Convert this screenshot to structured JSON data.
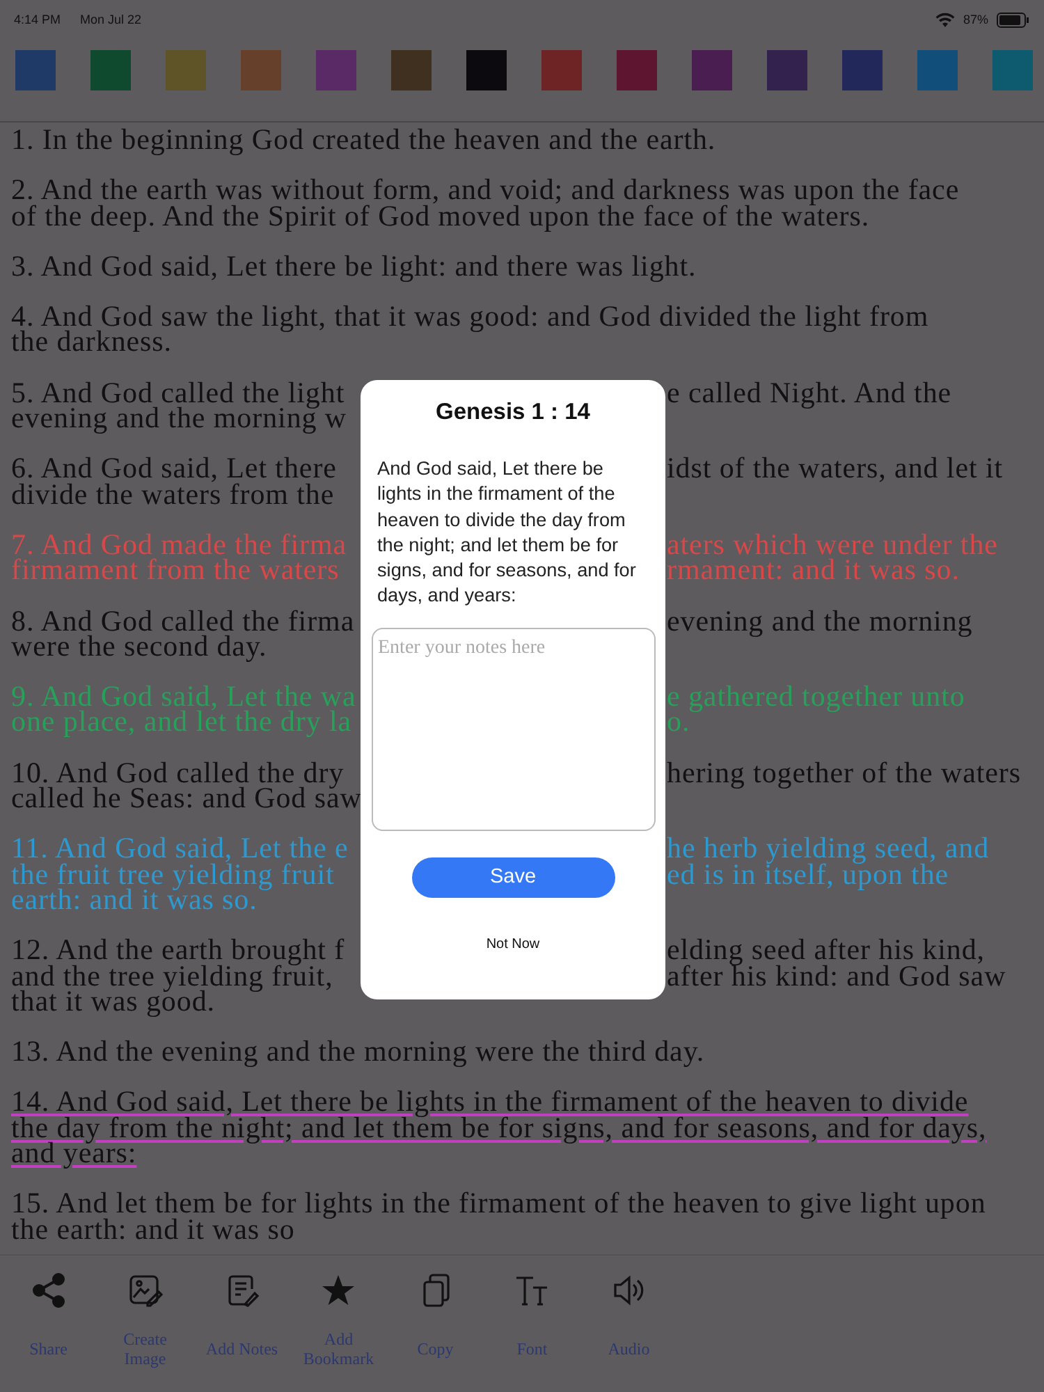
{
  "status_bar": {
    "time": "4:14 PM",
    "date": "Mon Jul 22",
    "battery": "87%"
  },
  "swatches": [
    {
      "color": "#1f3a66"
    },
    {
      "color": "#0f4a2e"
    },
    {
      "color": "#5e5428"
    },
    {
      "color": "#66402a"
    },
    {
      "color": "#5a2a66"
    },
    {
      "color": "#3f3020"
    },
    {
      "color": "#0c0a0e"
    },
    {
      "color": "#6e2424"
    },
    {
      "color": "#5e1630"
    },
    {
      "color": "#4a1e50"
    },
    {
      "color": "#33224e"
    },
    {
      "color": "#22285a"
    },
    {
      "color": "#124e7a"
    },
    {
      "color": "#0e5a6e"
    }
  ],
  "verses": [
    {
      "color": "#121014",
      "underlined": false,
      "lines": [
        {
          "left": "1. In the beginning God created the heaven and the earth."
        }
      ]
    },
    {
      "color": "#121014",
      "underlined": false,
      "lines": [
        {
          "left": "2. And the earth was without form, and void; and darkness was upon the face"
        },
        {
          "left": "of the deep. And the Spirit of God moved upon the face of the waters."
        }
      ]
    },
    {
      "color": "#121014",
      "underlined": false,
      "lines": [
        {
          "left": "3. And God said, Let there be light: and there was light."
        }
      ]
    },
    {
      "color": "#121014",
      "underlined": false,
      "lines": [
        {
          "left": "4. And God saw the light, that it was good: and God divided the light from"
        },
        {
          "left": "the darkness."
        }
      ]
    },
    {
      "color": "#121014",
      "underlined": false,
      "lines": [
        {
          "left": "5. And God called the light",
          "right": "e called Night. And the"
        },
        {
          "left": "evening and the morning w"
        }
      ]
    },
    {
      "color": "#121014",
      "underlined": false,
      "lines": [
        {
          "left": "6. And God said, Let there",
          "right": "idst of the waters, and let it"
        },
        {
          "left": "divide the waters from the"
        }
      ]
    },
    {
      "color": "#d84848",
      "underlined": false,
      "lines": [
        {
          "left": "7. And God made the firma",
          "right": "aters which were under the"
        },
        {
          "left": "firmament from the waters",
          "right": "rmament: and it was so."
        }
      ]
    },
    {
      "color": "#121014",
      "underlined": false,
      "lines": [
        {
          "left": "8. And God called the firma",
          "right": "evening and the morning"
        },
        {
          "left": "were the second day."
        }
      ]
    },
    {
      "color": "#27a05a",
      "underlined": false,
      "lines": [
        {
          "left": "9. And God said, Let the wa",
          "right": "e gathered together unto"
        },
        {
          "left": "one place, and let the dry la",
          "right": "o."
        }
      ]
    },
    {
      "color": "#121014",
      "underlined": false,
      "lines": [
        {
          "left": "10. And God called the dry",
          "right": "hering together of the waters"
        },
        {
          "left": "called he Seas: and God saw"
        }
      ]
    },
    {
      "color": "#2c9ad0",
      "underlined": false,
      "lines": [
        {
          "left": "11. And God said, Let the e",
          "right": "he herb yielding seed, and"
        },
        {
          "left": "the fruit tree yielding fruit",
          "right": "ed is in itself, upon the"
        },
        {
          "left": "earth: and it was so."
        }
      ]
    },
    {
      "color": "#121014",
      "underlined": false,
      "lines": [
        {
          "left": "12. And the earth brought f",
          "right": "elding seed after his kind,"
        },
        {
          "left": "and the tree yielding fruit,",
          "right": "after his kind: and God saw"
        },
        {
          "left": "that it was good."
        }
      ]
    },
    {
      "color": "#121014",
      "underlined": false,
      "lines": [
        {
          "left": "13. And the evening and the morning were the third day."
        }
      ]
    },
    {
      "color": "#121014",
      "underlined": true,
      "lines": [
        {
          "left": "14. And God said, Let there be lights in the firmament of the heaven to divide"
        },
        {
          "left": "the day from the night; and let them be for signs, and for seasons, and for days,"
        },
        {
          "left": "and years:"
        }
      ]
    },
    {
      "color": "#121014",
      "underlined": false,
      "lines": [
        {
          "left": "15. And let them be for lights in the firmament of the heaven to give light upon"
        },
        {
          "left": "the earth: and it was so"
        }
      ]
    }
  ],
  "toolbar": [
    {
      "kind": "share",
      "label": "Share"
    },
    {
      "kind": "image",
      "label": "Create Image"
    },
    {
      "kind": "notes",
      "label": "Add Notes"
    },
    {
      "kind": "bookmark",
      "label": "Add Bookmark"
    },
    {
      "kind": "copy",
      "label": "Copy"
    },
    {
      "kind": "font",
      "label": "Font"
    },
    {
      "kind": "audio",
      "label": "Audio"
    }
  ],
  "dialog": {
    "title": "Genesis 1 : 14",
    "body": "And God said, Let there be lights in the firmament of the heaven to divide the day from the night; and let them be for signs, and for seasons, and for days, and years:",
    "notes": {
      "placeholder": "Enter your notes here"
    },
    "save": "Save",
    "dismiss": "Not Now"
  }
}
